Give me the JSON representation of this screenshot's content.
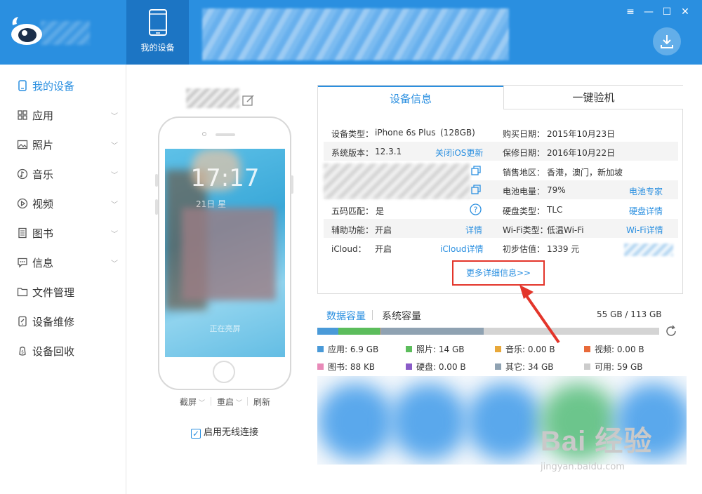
{
  "header": {
    "nav_label": "我的设备",
    "window_controls": [
      "≡",
      "—",
      "☐",
      "✕"
    ],
    "colors": {
      "header": "#2a8fe0",
      "active_tab": "#1c75c4"
    }
  },
  "sidebar": {
    "items": [
      {
        "label": "我的设备",
        "icon": "phone-icon",
        "active": true,
        "chevron": false
      },
      {
        "label": "应用",
        "icon": "apps-grid-icon",
        "chevron": true
      },
      {
        "label": "照片",
        "icon": "image-icon",
        "chevron": true
      },
      {
        "label": "音乐",
        "icon": "music-icon",
        "chevron": true
      },
      {
        "label": "视频",
        "icon": "play-icon",
        "chevron": true
      },
      {
        "label": "图书",
        "icon": "book-icon",
        "chevron": true
      },
      {
        "label": "信息",
        "icon": "message-icon",
        "chevron": true
      },
      {
        "label": "文件管理",
        "icon": "folder-icon",
        "chevron": false
      },
      {
        "label": "设备维修",
        "icon": "repair-icon",
        "chevron": false
      },
      {
        "label": "设备回收",
        "icon": "recycle-icon",
        "chevron": false
      }
    ]
  },
  "phone": {
    "lock_time": "17:17",
    "lock_date": "21日 星",
    "lock_hint": "正在亮屏",
    "actions": {
      "screenshot": "截屏",
      "restart": "重启",
      "refresh": "刷新"
    },
    "wireless": "启用无线连接"
  },
  "info": {
    "tabs": {
      "device_info": "设备信息",
      "quick_check": "一键验机"
    },
    "device_type": {
      "label": "设备类型：",
      "value": "iPhone 6s Plus",
      "extra": "(128GB)"
    },
    "os_version": {
      "label": "系统版本：",
      "value": "12.3.1",
      "link": "关闭iOS更新"
    },
    "imei_match": {
      "label": "五码匹配：",
      "value": "是",
      "icon": "help-icon"
    },
    "accessibility": {
      "label": "辅助功能：",
      "value": "开启",
      "link": "详情"
    },
    "icloud": {
      "label": "iCloud：",
      "value": "开启",
      "link": "iCloud详情"
    },
    "purchase_date": {
      "label": "购买日期：",
      "value": "2015年10月23日"
    },
    "warranty_date": {
      "label": "保修日期：",
      "value": "2016年10月22日"
    },
    "region": {
      "label": "销售地区：",
      "value": "香港，澳门，新加坡"
    },
    "battery": {
      "label": "电池电量：",
      "value": "79%",
      "link": "电池专家"
    },
    "disk_type": {
      "label": "硬盘类型：",
      "value": "TLC",
      "link": "硬盘详情"
    },
    "wifi_type": {
      "label": "Wi-Fi类型：",
      "value": "低温Wi-Fi",
      "link": "Wi-Fi详情"
    },
    "estimate": {
      "label": "初步估值：",
      "value": "1339 元"
    },
    "more_button": "更多详细信息>>"
  },
  "storage": {
    "tab_data": "数据容量",
    "tab_system": "系统容量",
    "total": "55 GB / 113 GB",
    "segments": [
      {
        "key": "apps",
        "percent": 6.1,
        "color": "#4a9ad8"
      },
      {
        "key": "photos",
        "percent": 12.4,
        "color": "#5cbd5c"
      },
      {
        "key": "music",
        "percent": 0,
        "color": "#e8a83a"
      },
      {
        "key": "video",
        "percent": 0,
        "color": "#e86a3a"
      },
      {
        "key": "books",
        "percent": 0.1,
        "color": "#e88ab8"
      },
      {
        "key": "disk",
        "percent": 0,
        "color": "#8a5cc8"
      },
      {
        "key": "other",
        "percent": 30.1,
        "color": "#8fa2b2"
      }
    ],
    "legend": [
      {
        "label": "应用: 6.9 GB",
        "color": "#4a9ad8"
      },
      {
        "label": "照片: 14 GB",
        "color": "#5cbd5c"
      },
      {
        "label": "音乐: 0.00 B",
        "color": "#e8a83a"
      },
      {
        "label": "视频: 0.00 B",
        "color": "#e86a3a"
      },
      {
        "label": "图书: 88 KB",
        "color": "#e88ab8"
      },
      {
        "label": "硬盘: 0.00 B",
        "color": "#8a5cc8"
      },
      {
        "label": "其它: 34 GB",
        "color": "#8fa2b2"
      },
      {
        "label": "可用: 59 GB",
        "color": "#cccccc"
      }
    ]
  },
  "watermark": {
    "main": "Bai 经验",
    "sub": "jingyan.baidu.com"
  }
}
